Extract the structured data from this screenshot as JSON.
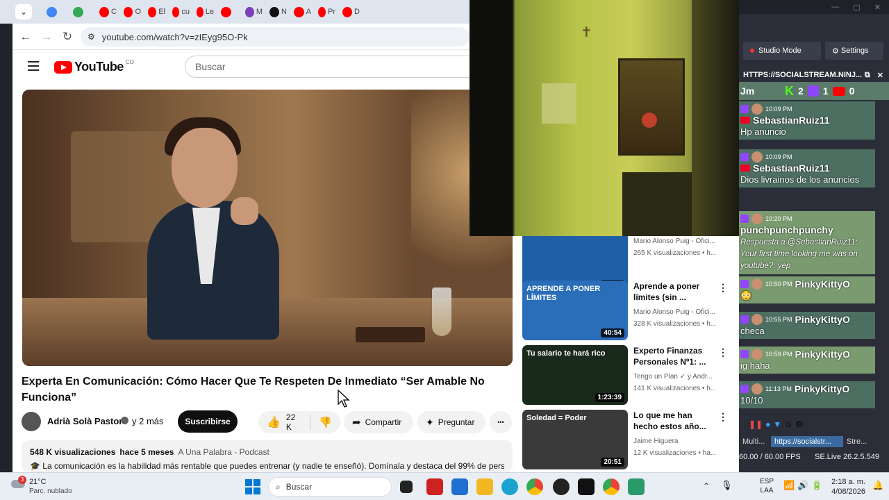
{
  "browser": {
    "tabs": [
      {
        "label": "",
        "color": "#25d366"
      },
      {
        "label": "",
        "color": "#4285f4"
      },
      {
        "label": "",
        "color": "#34a853"
      },
      {
        "label": "C",
        "color": "#ff0000"
      },
      {
        "label": "O",
        "color": "#ff0000"
      },
      {
        "label": "El",
        "color": "#ff0000"
      },
      {
        "label": "cu",
        "color": "#ff0000"
      },
      {
        "label": "Le",
        "color": "#ff0000"
      },
      {
        "label": "",
        "color": "#ff0000"
      },
      {
        "label": "M",
        "color": "#7b3fb8"
      },
      {
        "label": "N",
        "color": "#111111"
      },
      {
        "label": "A",
        "color": "#ff0000"
      },
      {
        "label": "Pr",
        "color": "#ff0000"
      },
      {
        "label": "D",
        "color": "#ff0000"
      }
    ],
    "url": "youtube.com/watch?v=zIEyg95O-Pk"
  },
  "youtube": {
    "logo_text": "YouTube",
    "country_code": "CO",
    "search_placeholder": "Buscar",
    "video_title": "Experta En Comunicación: Cómo Hacer Que Te Respeten De Inmediato “Ser Amable No Funciona”",
    "channel": "Adrià Solà Pastor",
    "channel_age": "y 2 más",
    "subscribe_label": "Suscribirse",
    "likes": "22 K",
    "share_label": "Compartir",
    "ask_label": "Preguntar",
    "more_label": "•••",
    "description": {
      "views": "548 K visualizaciones",
      "age": "hace 5 meses",
      "tag": "A Una Palabra - Podcast",
      "text": "La comunicación es la habilidad más rentable que puedes entrenar (y nadie te enseñó). Domínala y destaca del 99% de personas"
    }
  },
  "recommendations": [
    {
      "title": "",
      "channel": "Mario Alonso Puig - Ofici...",
      "views": "265 K visualizaciones • h...",
      "duration": "50:15",
      "thumb_text": "",
      "bg": "#1e5fa8"
    },
    {
      "title": "Aprende a poner límites (sin ...",
      "channel": "Mario Alonso Puig - Ofici...",
      "views": "328 K visualizaciones • h...",
      "duration": "40:54",
      "thumb_text": "APRENDE A PONER LÍMITES",
      "bg": "#2a6db8"
    },
    {
      "title": "Experto Finanzas Personales Nº1: ...",
      "channel": "Tengo un Plan ✓ y Andr...",
      "views": "141 K visualizaciones • h...",
      "duration": "1:23:39",
      "thumb_text": "Tu salario te hará rico",
      "bg": "#1a2a1a"
    },
    {
      "title": "Lo que me han hecho estos año...",
      "channel": "Jaime Higuera",
      "views": "12 K visualizaciones • ha...",
      "duration": "20:51",
      "thumb_text": "Soledad = Poder",
      "bg": "#3a3a3a"
    }
  ],
  "obs": {
    "studio_mode": "Studio Mode",
    "settings": "Settings",
    "dock_title": "HTTPS://SOCIALSTREAM.NINJ...",
    "top_user": "Jm",
    "kick_count": "2",
    "twitch_count": "1",
    "youtube_count": "0",
    "messages": [
      {
        "time": "10:09 PM",
        "name": "SebastianRuiz11",
        "text": "Hp anuncio",
        "bg": "#4d6f62"
      },
      {
        "time": "10:09 PM",
        "name": "SebastianRuiz11",
        "text": "Dios livrainos de los anuncios",
        "bg": "#4d6f62"
      },
      {
        "time": "10:20 PM",
        "name": "punchpunchpunchy",
        "text": "Respuesta a @SebastianRuiz11: Your first time looking me was on youtube?: yep",
        "bg": "#7a9a70"
      },
      {
        "time": "10:50 PM",
        "name": "PinkyKittyO",
        "text": "😳",
        "bg": "#7a9a70"
      },
      {
        "time": "10:55 PM",
        "name": "PinkyKittyO",
        "text": "checa",
        "bg": "#4d6f62"
      },
      {
        "time": "10:59 PM",
        "name": "PinkyKittyO",
        "text": "ig haha",
        "bg": "#7a9a70"
      },
      {
        "time": "11:13 PM",
        "name": "PinkyKittyO",
        "text": "10/10",
        "bg": "#4d6f62"
      }
    ],
    "tabs": [
      "Multi...",
      "https://socialstr...",
      "Stre..."
    ],
    "fps": "60.00 / 60.00 FPS",
    "version": "SE.Live 26.2.5.549"
  },
  "taskbar": {
    "weather_temp": "21°C",
    "weather_desc": "Parc. nublado",
    "weather_badge": "3",
    "search_label": "Buscar",
    "lang": "ESP",
    "lang2": "LAA",
    "time": "2:18 a. m.",
    "date": "4/08/2026"
  }
}
